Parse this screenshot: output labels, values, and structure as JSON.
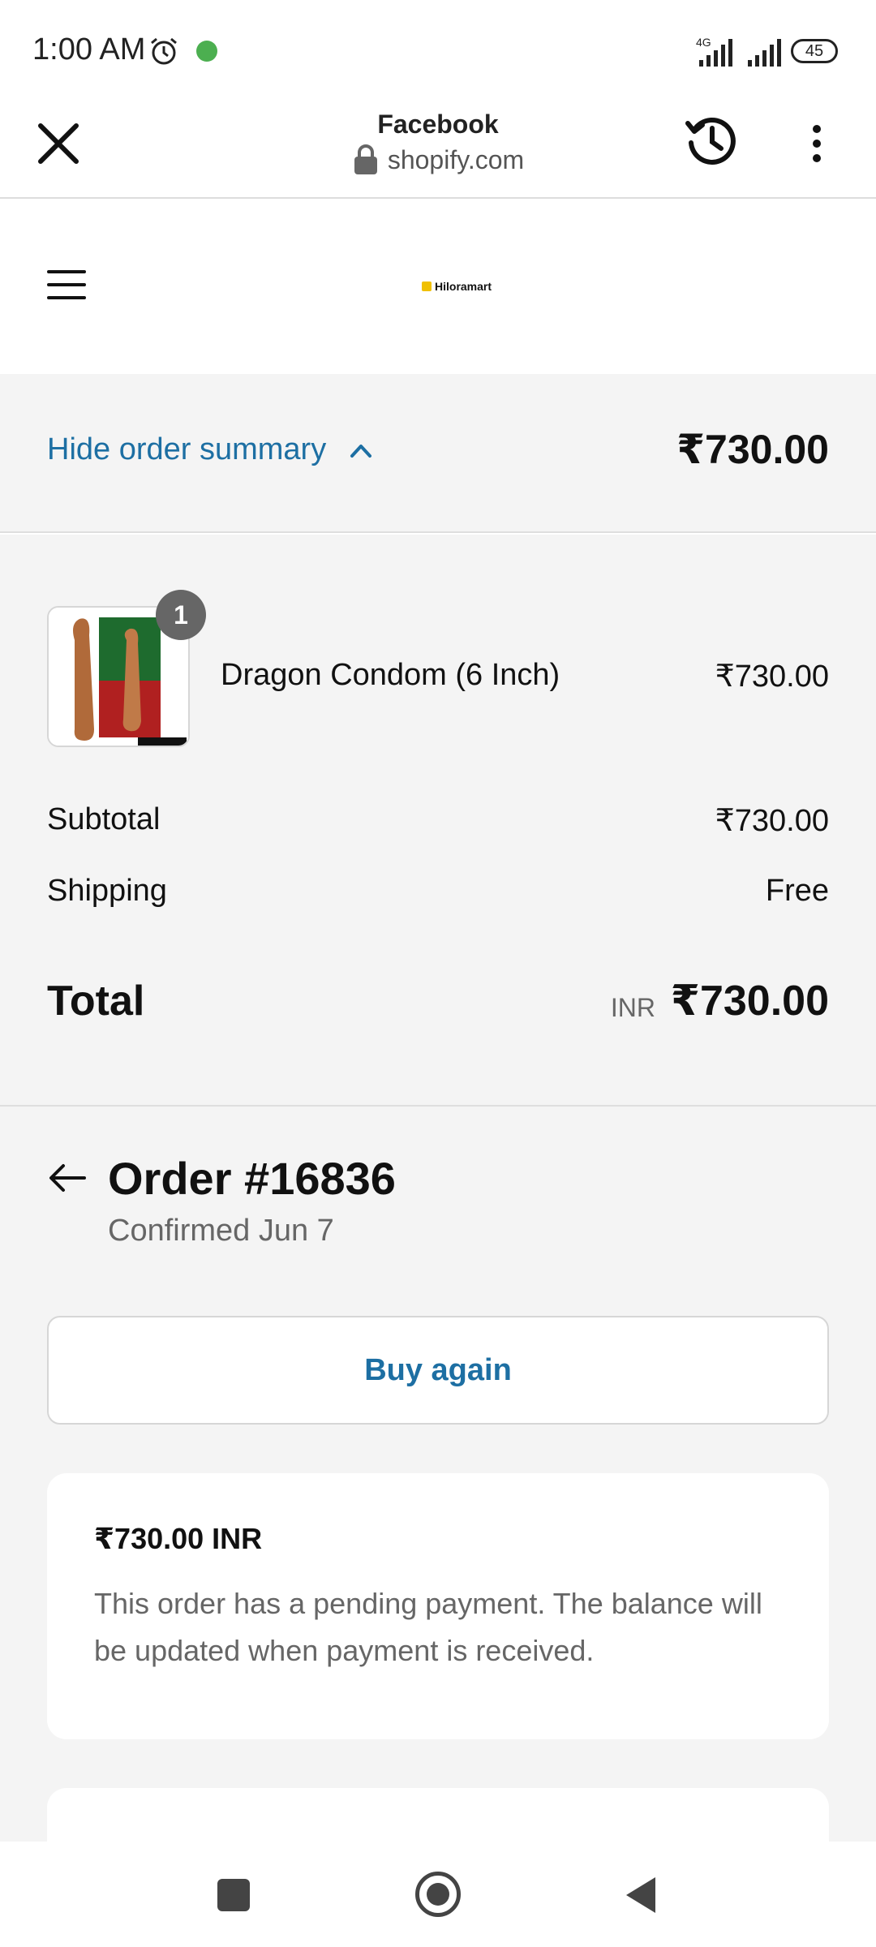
{
  "status_bar": {
    "time": "1:00 AM",
    "network": "4G",
    "battery": "45"
  },
  "browser": {
    "title": "Facebook",
    "url": "shopify.com"
  },
  "store": {
    "logo_text": "Hiloramart"
  },
  "summary_toggle": {
    "label": "Hide order summary",
    "total": "₹730.00"
  },
  "order_summary": {
    "item": {
      "quantity": "1",
      "name": "Dragon Condom (6 Inch)",
      "price": "₹730.00"
    },
    "subtotal_label": "Subtotal",
    "subtotal_value": "₹730.00",
    "shipping_label": "Shipping",
    "shipping_value": "Free",
    "total_label": "Total",
    "total_currency": "INR",
    "total_value": "₹730.00"
  },
  "order": {
    "title": "Order #16836",
    "status": "Confirmed Jun 7",
    "buy_again_label": "Buy again",
    "payment_amount": "₹730.00 INR",
    "payment_note": "This order has a pending payment. The balance will be updated when payment is received."
  },
  "colors": {
    "link": "#1d6fa3",
    "panel_bg": "#f4f4f4"
  }
}
